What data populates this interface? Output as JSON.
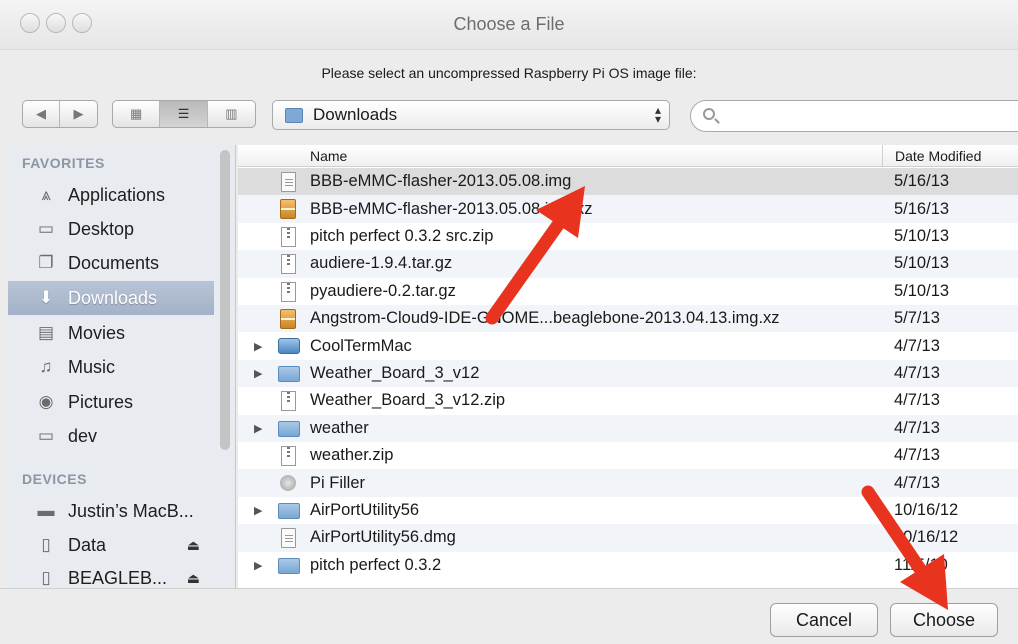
{
  "window": {
    "title": "Choose a File"
  },
  "prompt": "Please select an uncompressed Raspberry Pi OS image file:",
  "toolbar": {
    "back_icon": "chevron-left-icon",
    "forward_icon": "chevron-right-icon",
    "view_modes": [
      "icon-view-icon",
      "list-view-icon",
      "column-view-icon"
    ],
    "active_view": "list"
  },
  "location": {
    "value": "Downloads"
  },
  "search": {
    "placeholder": ""
  },
  "sidebar": {
    "favorites_header": "FAVORITES",
    "favorites": [
      {
        "label": "Applications",
        "icon": "applications-icon"
      },
      {
        "label": "Desktop",
        "icon": "desktop-icon"
      },
      {
        "label": "Documents",
        "icon": "documents-icon"
      },
      {
        "label": "Downloads",
        "icon": "downloads-icon",
        "selected": true
      },
      {
        "label": "Movies",
        "icon": "movies-icon"
      },
      {
        "label": "Music",
        "icon": "music-icon"
      },
      {
        "label": "Pictures",
        "icon": "pictures-icon"
      },
      {
        "label": "dev",
        "icon": "folder-icon"
      }
    ],
    "devices_header": "DEVICES",
    "devices": [
      {
        "label": "Justin’s MacB...",
        "icon": "laptop-icon",
        "eject": false
      },
      {
        "label": "Data",
        "icon": "drive-icon",
        "eject": true
      },
      {
        "label": "BEAGLEB...",
        "icon": "drive-icon",
        "eject": true
      }
    ]
  },
  "columns": {
    "name": "Name",
    "date": "Date Modified"
  },
  "files": [
    {
      "name": "BBB-eMMC-flasher-2013.05.08.img",
      "date": "5/16/13",
      "kind": "doc",
      "expandable": false
    },
    {
      "name": "BBB-eMMC-flasher-2013.05.08.img.xz",
      "date": "5/16/13",
      "kind": "xz",
      "expandable": false
    },
    {
      "name": "pitch perfect 0.3.2 src.zip",
      "date": "5/10/13",
      "kind": "zip",
      "expandable": false
    },
    {
      "name": "audiere-1.9.4.tar.gz",
      "date": "5/10/13",
      "kind": "zip",
      "expandable": false
    },
    {
      "name": "pyaudiere-0.2.tar.gz",
      "date": "5/10/13",
      "kind": "zip",
      "expandable": false
    },
    {
      "name": "Angstrom-Cloud9-IDE-GNOME...beaglebone-2013.04.13.img.xz",
      "date": "5/7/13",
      "kind": "xz",
      "expandable": false
    },
    {
      "name": "CoolTermMac",
      "date": "4/7/13",
      "kind": "app",
      "expandable": true
    },
    {
      "name": "Weather_Board_3_v12",
      "date": "4/7/13",
      "kind": "folder",
      "expandable": true
    },
    {
      "name": "Weather_Board_3_v12.zip",
      "date": "4/7/13",
      "kind": "zip",
      "expandable": false
    },
    {
      "name": "weather",
      "date": "4/7/13",
      "kind": "folder",
      "expandable": true
    },
    {
      "name": "weather.zip",
      "date": "4/7/13",
      "kind": "zip",
      "expandable": false
    },
    {
      "name": "Pi Filler",
      "date": "4/7/13",
      "kind": "filler",
      "expandable": false
    },
    {
      "name": "AirPortUtility56",
      "date": "10/16/12",
      "kind": "folder",
      "expandable": true
    },
    {
      "name": "AirPortUtility56.dmg",
      "date": "10/16/12",
      "kind": "doc",
      "expandable": false
    },
    {
      "name": "pitch perfect 0.3.2",
      "date": "11/5/10",
      "kind": "folder",
      "expandable": true
    }
  ],
  "buttons": {
    "cancel": "Cancel",
    "choose": "Choose"
  },
  "colors": {
    "selection_row": "#dcdcdc",
    "sidebar_selected": "#a3b2c8",
    "annotation_arrow": "#e8331f"
  }
}
